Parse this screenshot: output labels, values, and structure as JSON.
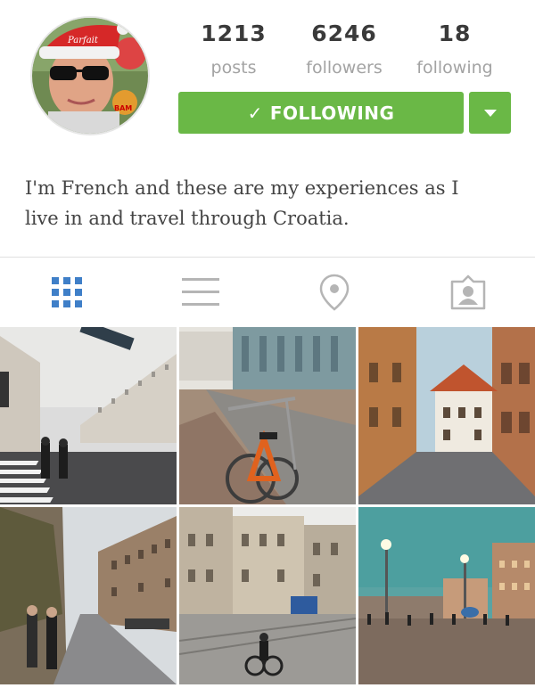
{
  "profile": {
    "avatar_text": "Parfait",
    "avatar_sticker": "BAM"
  },
  "stats": {
    "posts": {
      "value": "1213",
      "label": "posts"
    },
    "followers": {
      "value": "6246",
      "label": "followers"
    },
    "following": {
      "value": "18",
      "label": "following"
    }
  },
  "actions": {
    "follow_label": "FOLLOWING",
    "follow_color": "#6ab846"
  },
  "bio": {
    "line1": "I'm French and these are my experiences as I",
    "line2": "live in and travel through Croatia."
  },
  "tabs": [
    {
      "name": "grid-icon",
      "active": true
    },
    {
      "name": "list-icon",
      "active": false
    },
    {
      "name": "location-pin-icon",
      "active": false
    },
    {
      "name": "tagged-person-icon",
      "active": false
    }
  ],
  "colors": {
    "active_tab": "#3f7fc8",
    "inactive_tab": "#b5b5b5"
  },
  "photos": [
    {
      "name": "photo-crosswalk-street"
    },
    {
      "name": "photo-orange-bicycle"
    },
    {
      "name": "photo-orange-buildings-street"
    },
    {
      "name": "photo-street-with-people"
    },
    {
      "name": "photo-cyclist-tram-square"
    },
    {
      "name": "photo-evening-square"
    }
  ]
}
